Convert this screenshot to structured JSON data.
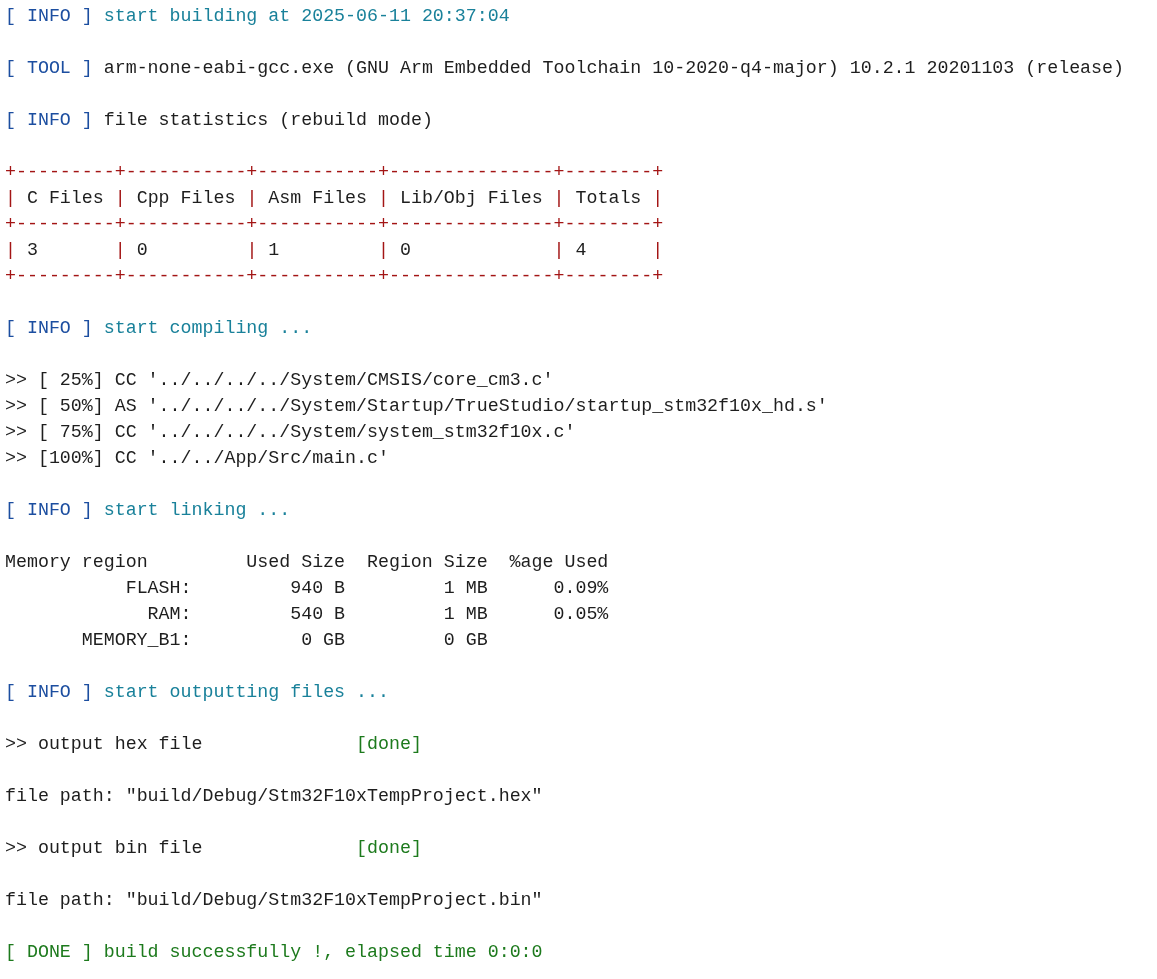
{
  "build_log": [
    {
      "kind": "status",
      "tag": "[ INFO ]",
      "message": "start building at 2025-06-11 20:37:04"
    },
    {
      "kind": "detail",
      "tag": "[ TOOL ]",
      "message": "arm-none-eabi-gcc.exe (GNU Arm Embedded Toolchain 10-2020-q4-major) 10.2.1 20201103 (release)"
    },
    {
      "kind": "detail",
      "tag": "[ INFO ]",
      "message": "file statistics (rebuild mode)"
    },
    {
      "kind": "ascii_table",
      "border": "+---------+-----------+-----------+---------------+--------+",
      "separator": "|",
      "columns": [
        "C Files",
        "Cpp Files",
        "Asm Files",
        "Lib/Obj Files",
        "Totals"
      ],
      "row": [
        "3",
        "0",
        "1",
        "0",
        "4"
      ]
    },
    {
      "kind": "status",
      "tag": "[ INFO ]",
      "message": "start compiling ..."
    },
    {
      "kind": "lines",
      "lines": [
        ">> [ 25%] CC '../../../../System/CMSIS/core_cm3.c'",
        ">> [ 50%] AS '../../../../System/Startup/TrueStudio/startup_stm32f10x_hd.s'",
        ">> [ 75%] CC '../../../../System/system_stm32f10x.c'",
        ">> [100%] CC '../../App/Src/main.c'"
      ]
    },
    {
      "kind": "status",
      "tag": "[ INFO ]",
      "message": "start linking ..."
    },
    {
      "kind": "memory_table",
      "columns": [
        "Memory region",
        "Used Size",
        "Region Size",
        "%age Used"
      ],
      "rows": [
        [
          "FLASH:",
          "940 B",
          "1 MB",
          "0.09%"
        ],
        [
          "RAM:",
          "540 B",
          "1 MB",
          "0.05%"
        ],
        [
          "MEMORY_B1:",
          "0 GB",
          "0 GB",
          ""
        ]
      ]
    },
    {
      "kind": "status",
      "tag": "[ INFO ]",
      "message": "start outputting files ..."
    },
    {
      "kind": "step",
      "label": ">> output hex file",
      "result": "[done]"
    },
    {
      "kind": "lines",
      "lines": [
        "file path: \"build/Debug/Stm32F10xTempProject.hex\""
      ]
    },
    {
      "kind": "step",
      "label": ">> output bin file",
      "result": "[done]"
    },
    {
      "kind": "lines",
      "lines": [
        "file path: \"build/Debug/Stm32F10xTempProject.bin\""
      ]
    },
    {
      "kind": "done",
      "tag": "[ DONE ]",
      "message": "build successfully !, elapsed time 0:0:0"
    }
  ]
}
